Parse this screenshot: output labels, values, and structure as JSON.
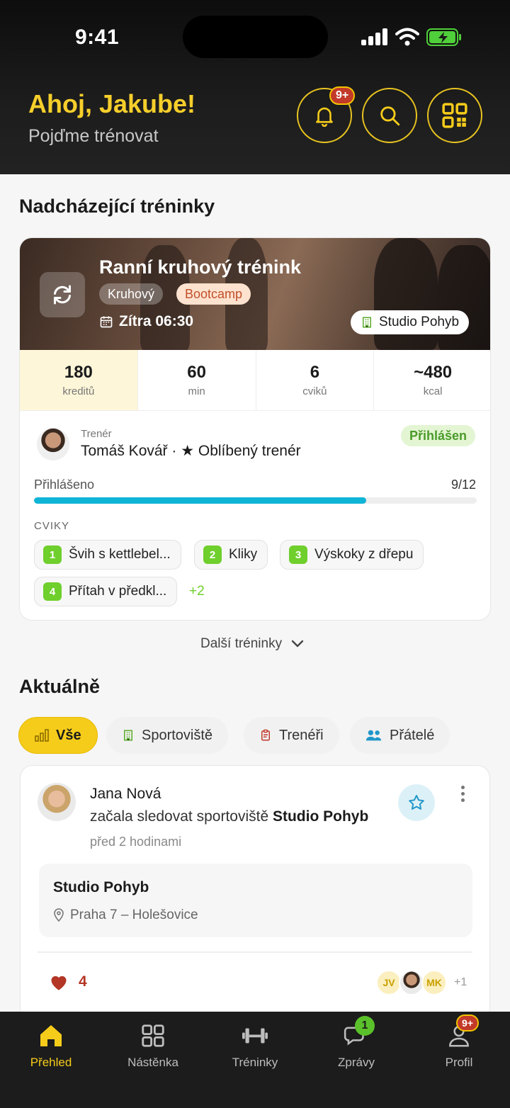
{
  "status": {
    "time": "9:41"
  },
  "header": {
    "greeting": "Ahoj, Jakube!",
    "subtitle": "Pojďme trénovat",
    "notif_badge": "9+"
  },
  "upcoming": {
    "title": "Nadcházející tréninky",
    "name": "Ranní kruhový trénink",
    "tags": [
      "Kruhový",
      "Bootcamp"
    ],
    "date": "Zítra 06:30",
    "studio": "Studio Pohyb",
    "stats": [
      {
        "value": "180",
        "label": "kreditů"
      },
      {
        "value": "60",
        "label": "min"
      },
      {
        "value": "6",
        "label": "cviků"
      },
      {
        "value": "~480",
        "label": "kcal"
      }
    ],
    "trainer_label": "Trenér",
    "trainer_name": "Tomáš Kovář · ★ Oblíbený trenér",
    "status_badge": "Přihlášen",
    "progress_label": "Přihlášeno",
    "progress_value": "9/12",
    "progress_fraction": 0.75,
    "exercises_label": "CVIKY",
    "exercises": [
      {
        "n": "1",
        "name": "Švih s kettlebel..."
      },
      {
        "n": "2",
        "name": "Kliky"
      },
      {
        "n": "3",
        "name": "Výskoky z dřepu"
      },
      {
        "n": "4",
        "name": "Přítah v předkl..."
      }
    ],
    "exercises_more": "+2",
    "more_link": "Další tréninky"
  },
  "feed": {
    "title": "Aktuálně",
    "filters": [
      "Vše",
      "Sportoviště",
      "Trenéři",
      "Přátelé"
    ],
    "post": {
      "author": "Jana Nová",
      "action": "začala sledovat sportoviště",
      "target": "Studio Pohyb",
      "time": "před 2 hodinami",
      "place_name": "Studio Pohyb",
      "place_location": "Praha 7 – Holešovice",
      "likes": "4",
      "avatars": [
        "JV",
        "MK"
      ],
      "avatars_more": "+1"
    }
  },
  "nav": {
    "items": [
      "Přehled",
      "Nástěnka",
      "Tréninky",
      "Zprávy",
      "Profil"
    ],
    "messages_badge": "1",
    "profile_badge": "9+"
  },
  "colors": {
    "accent": "#f6cc1a",
    "progress": "#0fb4d6",
    "exercise": "#6fcf2c",
    "header_bg": "#1a1a1a"
  }
}
